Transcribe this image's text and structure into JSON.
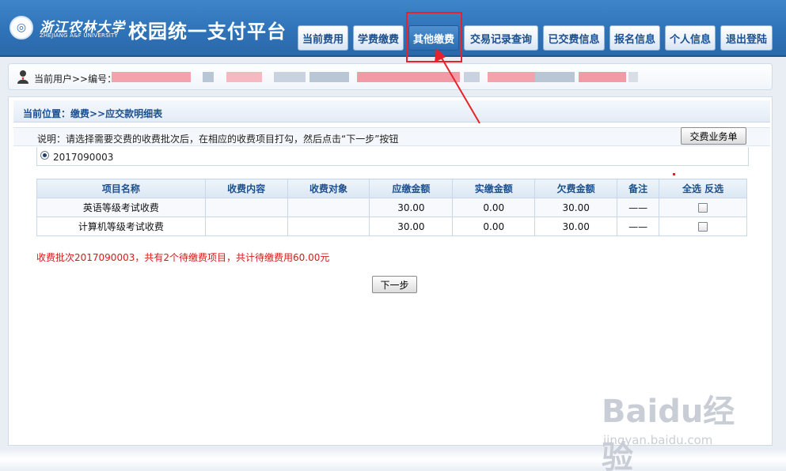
{
  "header": {
    "university_name_cn": "浙江农林大学",
    "university_name_en": "ZHEJIANG A&F UNIVERSITY",
    "site_title": "校园统一支付平台",
    "nav": [
      {
        "label": "当前费用",
        "active": false
      },
      {
        "label": "学费缴费",
        "active": false
      },
      {
        "label": "其他缴费",
        "active": true
      },
      {
        "label": "交易记录查询",
        "active": false
      },
      {
        "label": "已交费信息",
        "active": false
      },
      {
        "label": "报名信息",
        "active": false
      },
      {
        "label": "个人信息",
        "active": false
      },
      {
        "label": "退出登陆",
        "active": false
      }
    ]
  },
  "userbar": {
    "label": "当前用户>>编号："
  },
  "main": {
    "breadcrumb": "当前位置：缴费>>应交款明细表",
    "description": "说明：请选择需要交费的收费批次后，在相应的收费项目打勾，然后点击“下一步”按钮",
    "business_button": "交费业务单",
    "batch": "2017090003",
    "table": {
      "headers": [
        "项目名称",
        "收费内容",
        "收费对象",
        "应缴金额",
        "实缴金额",
        "欠费金额",
        "备注",
        "全选 反选"
      ],
      "rows": [
        [
          "英语等级考试收费",
          "",
          "",
          "30.00",
          "0.00",
          "30.00",
          "——"
        ],
        [
          "计算机等级考试收费",
          "",
          "",
          "30.00",
          "0.00",
          "30.00",
          "——"
        ]
      ]
    },
    "summary": "收费批次2017090003，共有2个待缴费项目，共计待缴费用60.00元",
    "next_button": "下一步"
  },
  "watermark": {
    "main": "Baidu经验",
    "sub": "jingyan.baidu.com"
  },
  "colors": {
    "header_blue": "#2f73b8",
    "highlight_red": "#e8222a",
    "summary_red": "#d71a1a"
  }
}
